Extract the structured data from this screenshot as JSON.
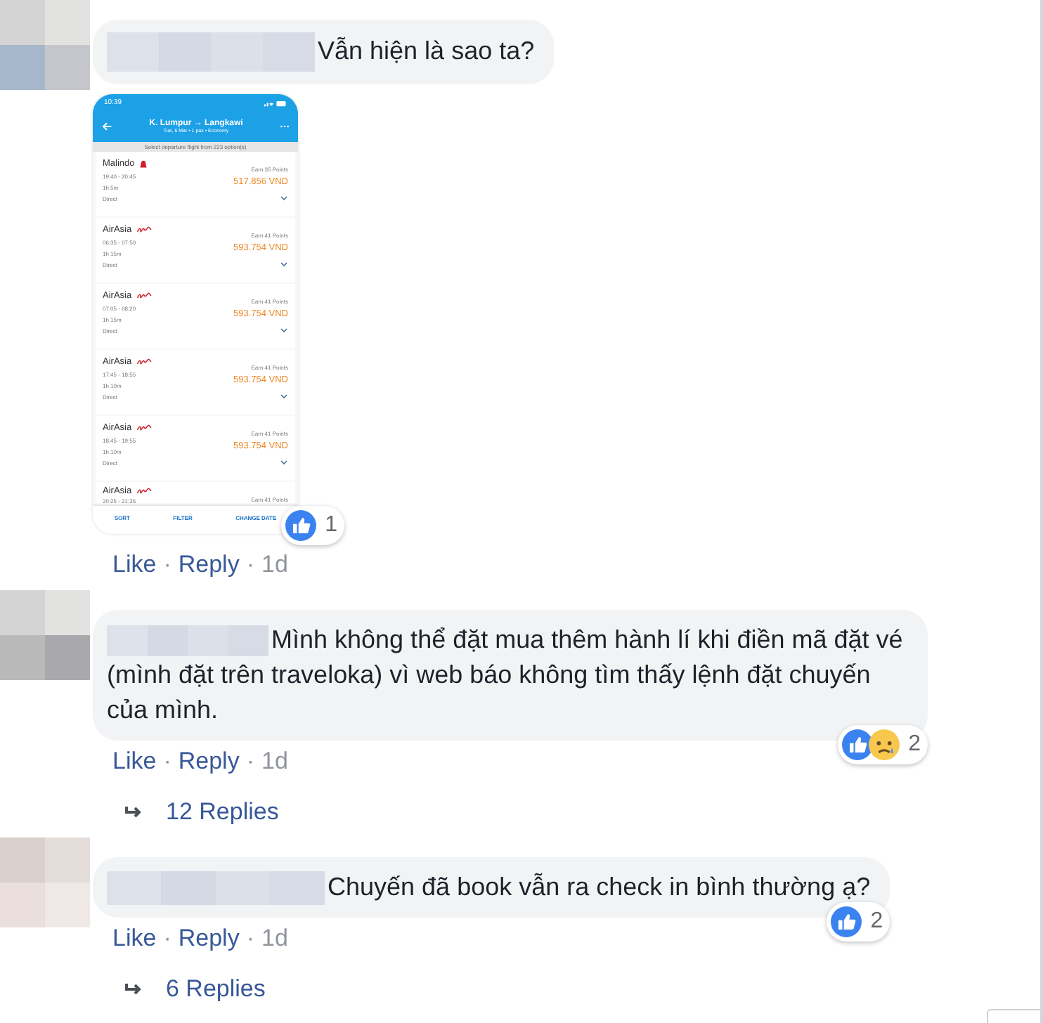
{
  "comments": [
    {
      "text": "Vẫn hiện là sao ta?",
      "attachment": {
        "kind": "phone-screenshot",
        "status_time": "10:39",
        "title": "K. Lumpur → Langkawi",
        "subtitle": "Tue, 6 Mar • 1 pax • Economy",
        "banner": "Select departure flight from 223 option(s)",
        "flights": [
          {
            "airline": "Malindo",
            "kind": "malindo",
            "time": "19:40 - 20:45",
            "duration": "1h 5m",
            "stops": "Direct",
            "points": "Earn 35 Points",
            "price": "517.856 VND"
          },
          {
            "airline": "AirAsia",
            "kind": "airasia",
            "time": "06:35 - 07:50",
            "duration": "1h 15m",
            "stops": "Direct",
            "points": "Earn 41 Points",
            "price": "593.754 VND"
          },
          {
            "airline": "AirAsia",
            "kind": "airasia",
            "time": "07:05 - 08:20",
            "duration": "1h 15m",
            "stops": "Direct",
            "points": "Earn 41 Points",
            "price": "593.754 VND"
          },
          {
            "airline": "AirAsia",
            "kind": "airasia",
            "time": "17:45 - 18:55",
            "duration": "1h 10m",
            "stops": "Direct",
            "points": "Earn 41 Points",
            "price": "593.754 VND"
          },
          {
            "airline": "AirAsia",
            "kind": "airasia",
            "time": "18:45 - 19:55",
            "duration": "1h 10m",
            "stops": "Direct",
            "points": "Earn 41 Points",
            "price": "593.754 VND"
          },
          {
            "airline": "AirAsia",
            "kind": "airasia",
            "time": "20:25 - 21:35",
            "points": "Earn 41 Points"
          }
        ],
        "bottom_bar": [
          "SORT",
          "FILTER",
          "CHANGE DATE"
        ]
      },
      "reactions": [
        {
          "kind": "like"
        }
      ],
      "reaction_count": "1",
      "actions": {
        "like": "Like",
        "reply": "Reply",
        "time": "1d"
      }
    },
    {
      "text": "Mình không thể đặt mua thêm hành lí khi điền mã đặt vé (mình đặt trên traveloka) vì web báo không tìm thấy lệnh đặt chuyến của mình.",
      "reactions": [
        {
          "kind": "like"
        },
        {
          "kind": "sad"
        }
      ],
      "reaction_count": "2",
      "actions": {
        "like": "Like",
        "reply": "Reply",
        "time": "1d"
      },
      "replies": "12 Replies"
    },
    {
      "text": "Chuyến đã book vẫn ra check in bình thường ạ?",
      "reactions": [
        {
          "kind": "like"
        }
      ],
      "reaction_count": "2",
      "actions": {
        "like": "Like",
        "reply": "Reply",
        "time": "1d"
      },
      "replies": "6 Replies"
    }
  ],
  "separator": "·"
}
